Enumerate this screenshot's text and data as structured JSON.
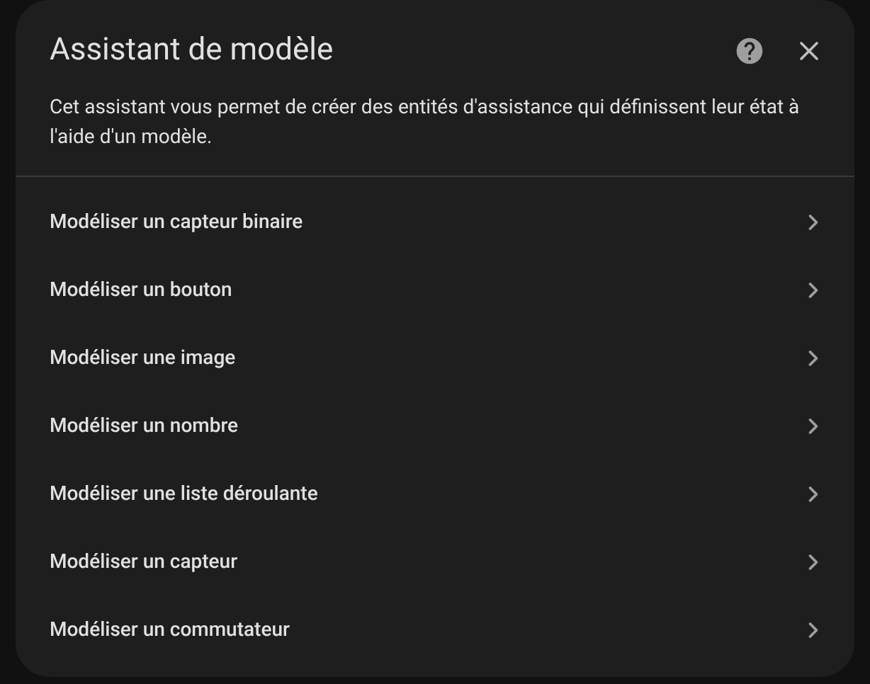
{
  "dialog": {
    "title": "Assistant de modèle",
    "description": "Cet assistant vous permet de créer des entités d'assistance qui définissent leur état à l'aide d'un modèle.",
    "items": [
      {
        "label": "Modéliser un capteur binaire"
      },
      {
        "label": "Modéliser un bouton"
      },
      {
        "label": "Modéliser une image"
      },
      {
        "label": "Modéliser un nombre"
      },
      {
        "label": "Modéliser une liste déroulante"
      },
      {
        "label": "Modéliser un capteur"
      },
      {
        "label": "Modéliser un commutateur"
      }
    ]
  }
}
